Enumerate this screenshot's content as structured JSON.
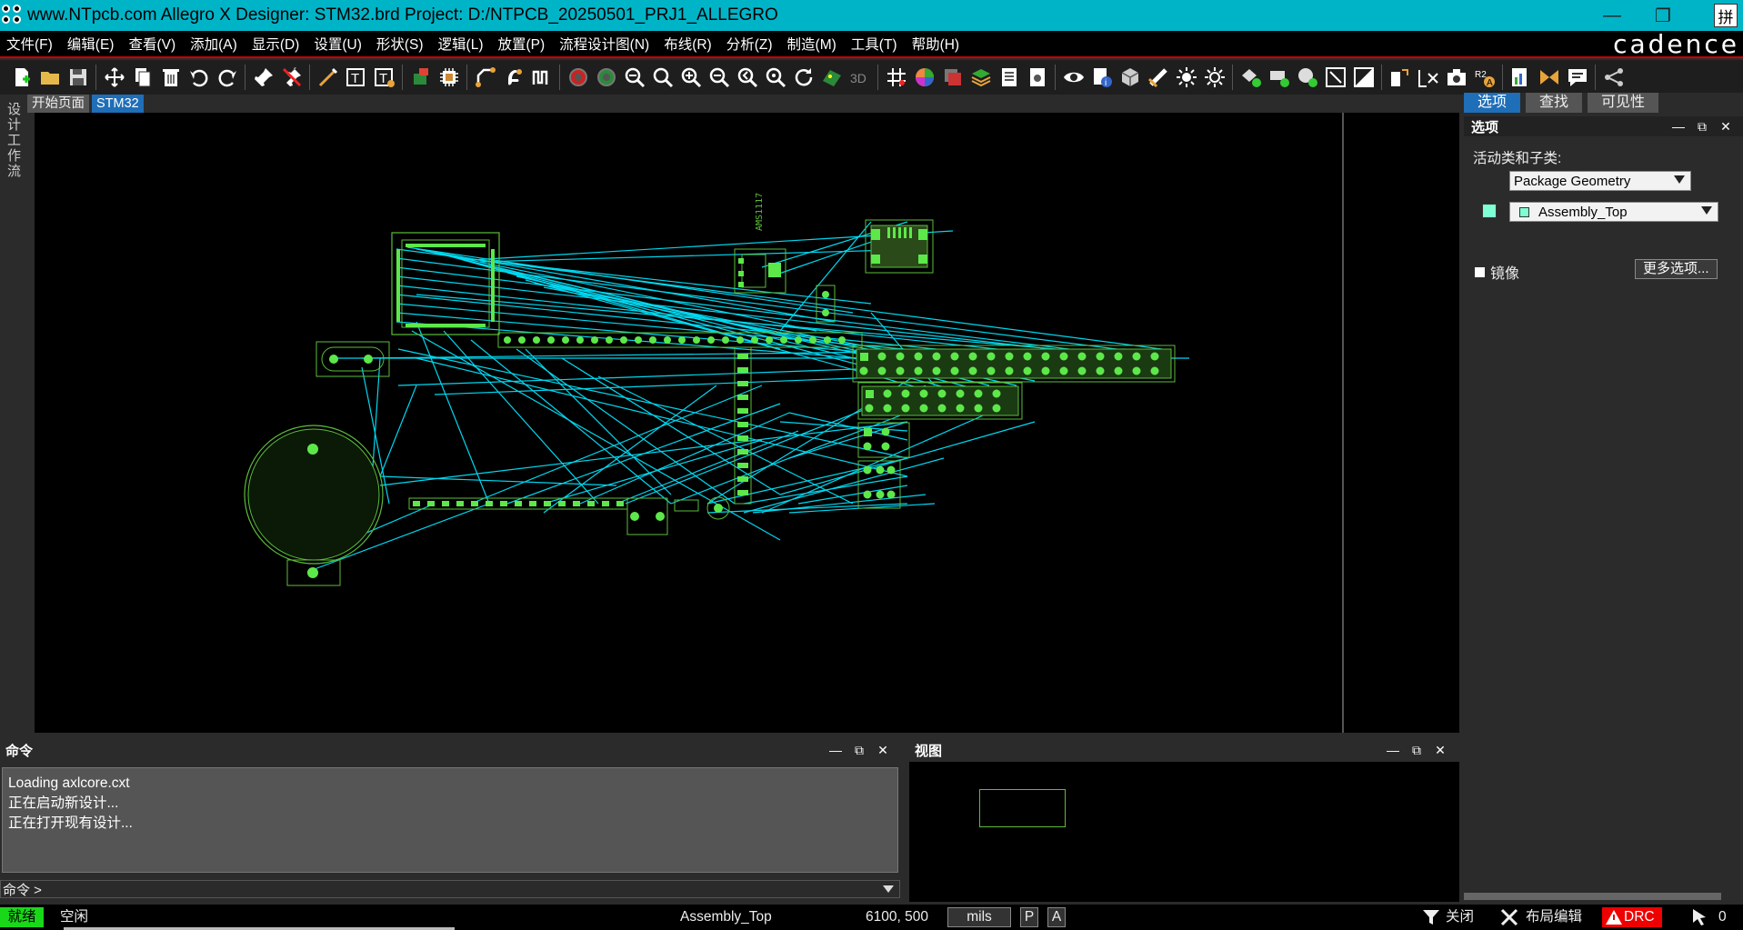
{
  "window": {
    "title": "www.NTpcb.com Allegro X Designer: STM32.brd  Project: D:/NTPCB_20250501_PRJ1_ALLEGRO",
    "ime_label": "拼"
  },
  "menu": {
    "items": [
      "文件(F)",
      "编辑(E)",
      "查看(V)",
      "添加(A)",
      "显示(D)",
      "设置(U)",
      "形状(S)",
      "逻辑(L)",
      "放置(P)",
      "流程设计图(N)",
      "布线(R)",
      "分析(Z)",
      "制造(M)",
      "工具(T)",
      "帮助(H)"
    ],
    "brand": "cadence"
  },
  "side_tab": "设计工作流",
  "doc_tabs": {
    "start": "开始页面",
    "active": "STM32"
  },
  "canvas": {
    "component_label": "AMS1117"
  },
  "right_panel": {
    "tabs": [
      "选项",
      "查找",
      "可见性"
    ],
    "title": "选项",
    "class_label": "活动类和子类:",
    "class_value": "Package Geometry",
    "subclass_value": "Assembly_Top",
    "mirror_label": "镜像",
    "more_options": "更多选项..."
  },
  "command_panel": {
    "title": "命令",
    "lines": [
      "Loading axlcore.cxt",
      "正在启动新设计...",
      "正在打开现有设计..."
    ],
    "prompt": "命令 >"
  },
  "view_panel": {
    "title": "视图"
  },
  "status": {
    "ready": "就绪",
    "idle": "空闲",
    "subclass": "Assembly_Top",
    "coords": "6100, 500",
    "units": "mils",
    "p_label": "P",
    "a_label": "A",
    "filter_label": "关闭",
    "mode_label": "布局编辑",
    "drc_label": "DRC",
    "count": "0"
  },
  "colors": {
    "titlebar": "#00b4c8",
    "accent_tab": "#1e6eb8",
    "ratsnest": "#00d8f0",
    "component_outline": "#5bbd3a",
    "pad": "#5de84a",
    "drc": "#e00000",
    "ready": "#19d819"
  }
}
